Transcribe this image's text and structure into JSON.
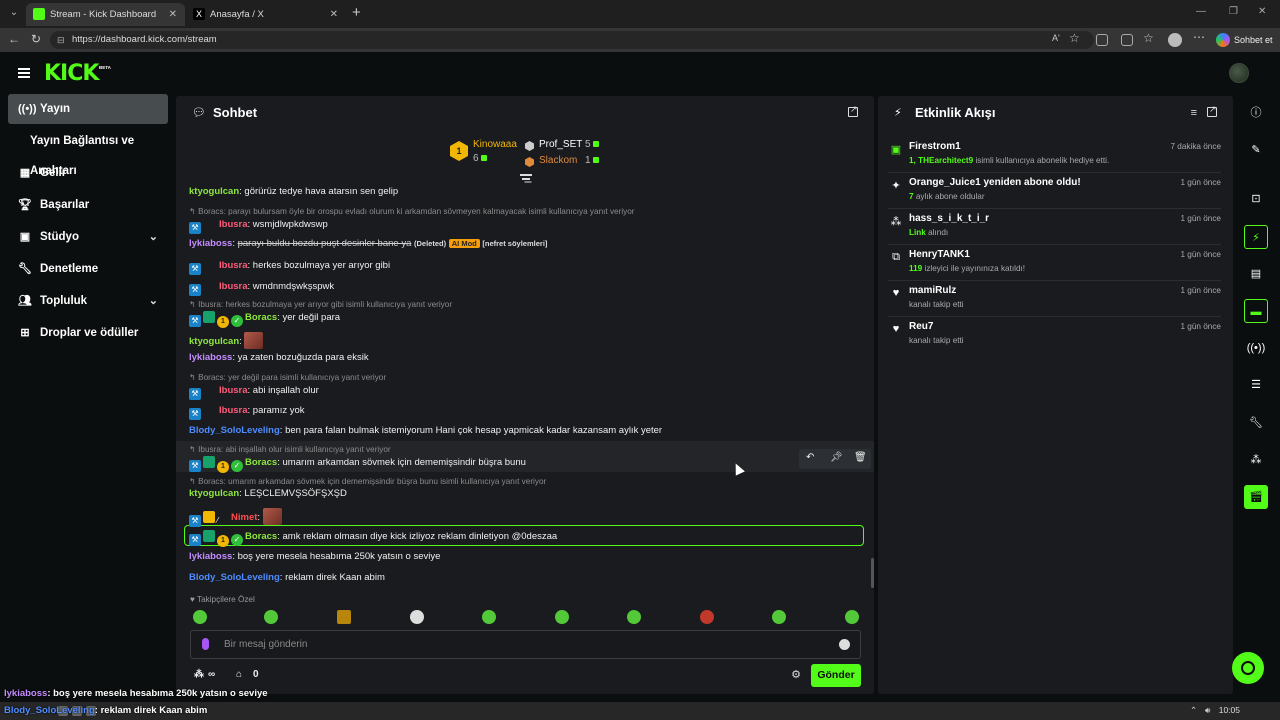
{
  "browser": {
    "tabs": [
      {
        "title": "Stream - Kick Dashboard",
        "active": true
      },
      {
        "title": "Anasayfa / X",
        "active": false
      }
    ],
    "url": "https://dashboard.kick.com/stream",
    "copilot_label": "Sohbet et",
    "read_aloud": "Aʹ"
  },
  "app": {
    "logo": "KICK",
    "beta": "BETA",
    "accent": "#53fc18"
  },
  "sidebar": {
    "items": [
      {
        "label": "Yayın",
        "icon": "broadcast-icon",
        "active": true
      },
      {
        "label": "Yayın Bağlantısı ve Anahtarı",
        "sub": true
      },
      {
        "label": "Gelir",
        "icon": "revenue-icon"
      },
      {
        "label": "Başarılar",
        "icon": "trophy-icon"
      },
      {
        "label": "Stüdyo",
        "icon": "studio-icon",
        "expandable": true
      },
      {
        "label": "Denetleme",
        "icon": "wrench-icon"
      },
      {
        "label": "Topluluk",
        "icon": "community-icon",
        "expandable": true
      },
      {
        "label": "Droplar ve ödüller",
        "icon": "drops-icon"
      }
    ]
  },
  "chat": {
    "title": "Sohbet",
    "leaderboard": {
      "first": {
        "name": "Kinowaaa",
        "count": "6",
        "rank": "1"
      },
      "second": {
        "name": "Prof_SET",
        "count": "5"
      },
      "third": {
        "name": "Slackom",
        "count": "1"
      }
    },
    "messages": [
      {
        "user": "ktyogulcan",
        "text": " görürüz tedye hava atarsın sen gelip"
      },
      {
        "reply": "Boracs: parayı bulursam öyle bir orospu evladı olurum ki arkamdan sövmeyen kalmayacak isimli kullanıcıya yanıt veriyor"
      },
      {
        "user": "Ibusra",
        "text": " wsmjdlwpkdwswp"
      },
      {
        "user": "lykiaboss",
        "text": "parayı buldu bozdu puşt desinler bane ya",
        "deleted": "(Deleted)",
        "aimod": "AI Mod",
        "tag": "[nefret söylemleri]"
      },
      {
        "user": "Ibusra",
        "text": " herkes bozulmaya yer arıyor gibi"
      },
      {
        "user": "Ibusra",
        "text": " wmdnmdşwkşspwk"
      },
      {
        "reply": "Ibusra: herkes bozulmaya yer arıyor gibi isimli kullanıcıya yanıt veriyor"
      },
      {
        "user": "Boracs",
        "text": " yer değil para"
      },
      {
        "user": "ktyogulcan",
        "text": ""
      },
      {
        "user": "lykiaboss",
        "text": " ya zaten bozuğuzda para eksik"
      },
      {
        "reply": "Boracs: yer değil para isimli kullanıcıya yanıt veriyor"
      },
      {
        "user": "Ibusra",
        "text": " abi inşallah olur"
      },
      {
        "user": "Ibusra",
        "text": " paramız yok"
      },
      {
        "user": "Blody_SoloLeveling",
        "text": " ben para falan bulmak istemiyorum Hani çok hesap yapmicak kadar kazansam aylık yeter"
      },
      {
        "reply": "Ibusra: abi inşallah olur isimli kullanıcıya yanıt veriyor"
      },
      {
        "user": "Boracs",
        "text": " umarım arkamdan sövmek için dememişsindir büşra bunu"
      },
      {
        "reply": "Boracs: umarım arkamdan sövmek için dememişsindir büşra bunu isimli kullanıcıya yanıt veriyor"
      },
      {
        "user": "ktyogulcan",
        "text": " LEŞCLEMVŞSÖFŞXŞD"
      },
      {
        "user": "Nimet",
        "text": ""
      },
      {
        "user": "Boracs",
        "text": " amk reklam olmasın diye kick izliyoz reklam dinletiyon @0deszaa"
      },
      {
        "user": "lykiaboss",
        "text": " boş yere mesela hesabıma 250k yatsın o seviye"
      },
      {
        "user": "Blody_SoloLeveling",
        "text": " reklam direk Kaan abim"
      }
    ],
    "emote_section": "Takipçilere Özel",
    "input_placeholder": "Bir mesaj gönderin",
    "points_symbol": "∞",
    "points_count": "0",
    "send_label": "Gönder"
  },
  "activity": {
    "title": "Etkinlik Akışı",
    "events": [
      {
        "name": "Firestrom1",
        "detail_bold": "1, THEarchitect9",
        "detail": " isimli kullanıcıya abonelik hediye etti.",
        "time": "7 dakika önce",
        "icon": "gift-icon"
      },
      {
        "name": "Orange_Juice1 yeniden abone oldu!",
        "detail_bold": "7",
        "detail": " aylık abone oldular",
        "time": "1 gün önce",
        "icon": "star-icon"
      },
      {
        "name": "hass_s_i_k_t_i_r",
        "detail_bold": "Link",
        "detail": " alındı",
        "time": "1 gün önce",
        "icon": "drops-icon"
      },
      {
        "name": "HenryTANK1",
        "detail_bold": "119",
        "detail": " izleyici ile yayınınıza katıldı!",
        "time": "1 gün önce",
        "icon": "raid-icon"
      },
      {
        "name": "mamiRulz",
        "detail_bold": "",
        "detail": "kanalı takip etti",
        "time": "1 gün önce",
        "icon": "heart-icon"
      },
      {
        "name": "Reu7",
        "detail_bold": "",
        "detail": "kanalı takip etti",
        "time": "1 gün önce",
        "icon": "heart-icon"
      }
    ]
  },
  "overlay": {
    "line1_user": "lykiaboss",
    "line1_text": ": boş yere mesela hesabıma 250k yatsın o seviye",
    "line2_user": "Blody_SoloLeveling",
    "line2_text": ": reklam direk Kaan abim"
  },
  "taskbar": {
    "clock": "10:05"
  }
}
